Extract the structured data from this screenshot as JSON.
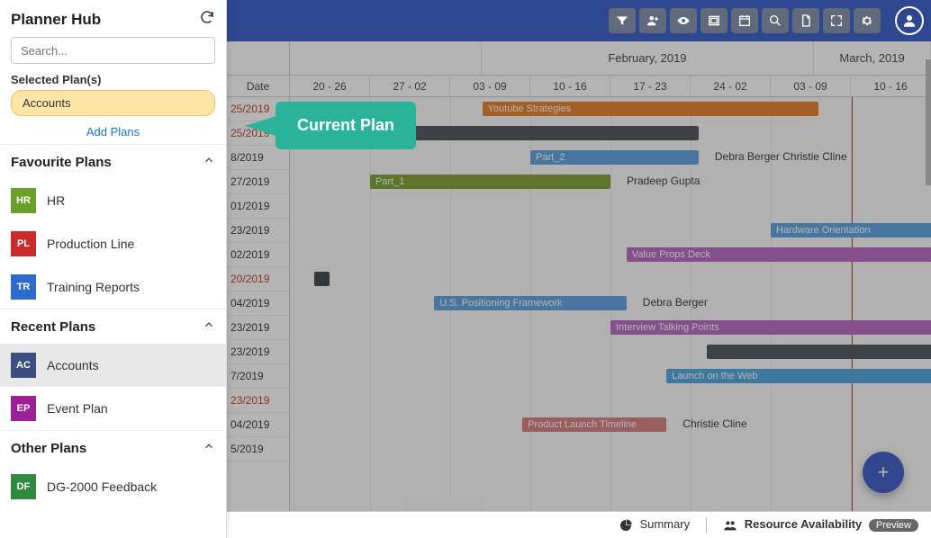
{
  "sidebar": {
    "title": "Planner Hub",
    "search_placeholder": "Search...",
    "selected_label": "Selected Plan(s)",
    "selected_plan": "Accounts",
    "add_plans": "Add Plans",
    "sections": {
      "favourite": {
        "label": "Favourite Plans",
        "items": [
          {
            "abbr": "HR",
            "label": "HR",
            "color": "#6aa029"
          },
          {
            "abbr": "PL",
            "label": "Production Line",
            "color": "#cc2b2b"
          },
          {
            "abbr": "TR",
            "label": "Training Reports",
            "color": "#2d6bcc"
          }
        ]
      },
      "recent": {
        "label": "Recent Plans",
        "items": [
          {
            "abbr": "AC",
            "label": "Accounts",
            "color": "#3a4f80",
            "active": true
          },
          {
            "abbr": "EP",
            "label": "Event Plan",
            "color": "#9e1f96"
          }
        ]
      },
      "other": {
        "label": "Other Plans",
        "items": [
          {
            "abbr": "DF",
            "label": "DG-2000 Feedback",
            "color": "#2e8b3e"
          }
        ]
      }
    }
  },
  "callout": "Current Plan",
  "toolbar_icons": [
    "filter",
    "user-add",
    "eye",
    "layout",
    "calendar",
    "search",
    "document",
    "expand",
    "gear"
  ],
  "timeline": {
    "date_header": "Date",
    "months": [
      {
        "label": "February, 2019",
        "span": 4
      },
      {
        "label": "March, 2019",
        "span": 1.2
      }
    ],
    "weeks": [
      "20 - 26",
      "27 - 02",
      "03 - 09",
      "10 - 16",
      "17 - 23",
      "24 - 02",
      "03 - 09",
      "10 - 16"
    ],
    "dates": [
      "25/2019",
      "25/2019",
      "8/2019",
      "27/2019",
      "01/2019",
      "23/2019",
      "02/2019",
      "20/2019",
      "04/2019",
      "23/2019",
      "23/2019",
      "7/2019",
      "23/2019",
      "04/2019",
      "5/2019"
    ],
    "red_dates": [
      0,
      1,
      7,
      12
    ]
  },
  "chart_data": {
    "type": "gantt",
    "today_date": "2019-03-07",
    "tasks": [
      {
        "row": 0,
        "label": "Youtube Strategies",
        "start_week": 2.4,
        "end_week": 6.6,
        "color": "orange"
      },
      {
        "row": 1,
        "label": "",
        "start_week": 0,
        "end_week": 5.1,
        "color": "dark"
      },
      {
        "row": 2,
        "label": "Part_2",
        "start_week": 3.0,
        "end_week": 5.1,
        "color": "blue",
        "assignees": [
          "Debra Berger",
          "Christie Cline"
        ]
      },
      {
        "row": 3,
        "label": "Part_1",
        "start_week": 1.0,
        "end_week": 4.0,
        "color": "green",
        "assignees": [
          "Pradeep Gupta"
        ]
      },
      {
        "row": 5,
        "label": "Hardware Orientation",
        "start_week": 6.0,
        "end_week": 8.5,
        "color": "blue"
      },
      {
        "row": 6,
        "label": "Value Props Deck",
        "start_week": 4.2,
        "end_week": 8.5,
        "color": "purple"
      },
      {
        "row": 7,
        "label": "",
        "start_week": 0.3,
        "end_week": 0.5,
        "color": "navy"
      },
      {
        "row": 8,
        "label": "U.S. Positioning Framework",
        "start_week": 1.8,
        "end_week": 4.2,
        "color": "blue",
        "assignees": [
          "Debra Berger"
        ]
      },
      {
        "row": 9,
        "label": "Interview Talking Points",
        "start_week": 4.0,
        "end_week": 8.5,
        "color": "purple"
      },
      {
        "row": 10,
        "label": "",
        "start_week": 5.2,
        "end_week": 8.5,
        "color": "dark"
      },
      {
        "row": 11,
        "label": "Launch on the Web",
        "start_week": 4.7,
        "end_week": 8.5,
        "color": "sky"
      },
      {
        "row": 13,
        "label": "Product Launch Timeline",
        "start_week": 2.9,
        "end_week": 4.7,
        "color": "salmon",
        "assignees": [
          "Christie Cline"
        ]
      }
    ]
  },
  "footer": {
    "summary": "Summary",
    "resource": "Resource Availability",
    "preview": "Preview"
  },
  "colors": {
    "green": "#6aa029",
    "red": "#cc2b2b",
    "blue": "#2d6bcc",
    "navy": "#3a4f80",
    "magenta": "#9e1f96",
    "dgreen": "#2e8b3e"
  }
}
